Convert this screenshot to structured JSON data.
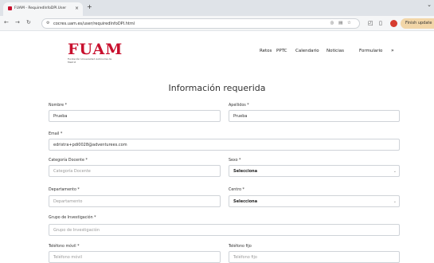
{
  "browser": {
    "tab_title": "FUAM - RequiredInfoDPI.User",
    "tab_close": "×",
    "new_tab": "+",
    "window_control": "⌄",
    "url": "cocres.uam.es/user/requiredInfoDPI.html",
    "update_label": "Finish update"
  },
  "header": {
    "logo_text": "FUAM",
    "logo_subtitle": "Fundación Universidad Autónoma de Madrid",
    "nav": [
      "Retos",
      "PPTC",
      "Calendario",
      "Noticias",
      "Formulario"
    ],
    "nav_more": "»"
  },
  "page": {
    "title": "Información requerida"
  },
  "form": {
    "nombre": {
      "label": "Nombre *",
      "value": "Prueba"
    },
    "apellidos": {
      "label": "Apellidos *",
      "value": "Prueba"
    },
    "email": {
      "label": "Email *",
      "value": "edristra+pdi0028@adventurees.com"
    },
    "categoria": {
      "label": "Categoría Docente *",
      "placeholder": "Categoría Docente"
    },
    "sexo": {
      "label": "Sexo *",
      "value": "Selecciona"
    },
    "departamento": {
      "label": "Departamento *",
      "placeholder": "Departamento"
    },
    "centro": {
      "label": "Centro *",
      "value": "Selecciona"
    },
    "grupo": {
      "label": "Grupo de Investigación *",
      "placeholder": "Grupo de Investigación"
    },
    "movil": {
      "label": "Teléfono móvil *",
      "placeholder": "Teléfono móvil"
    },
    "fijo": {
      "label": "Teléfono fijo",
      "placeholder": "Teléfono fijo"
    }
  },
  "colors": {
    "brand": "#c8102e"
  }
}
